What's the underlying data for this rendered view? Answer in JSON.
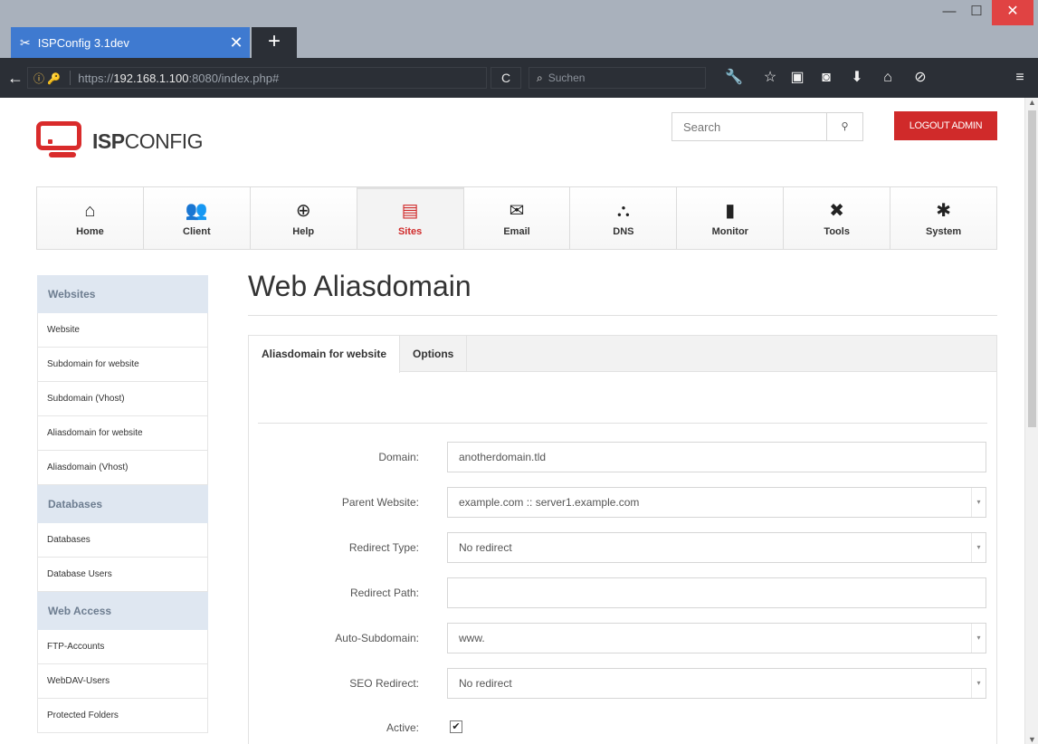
{
  "browser": {
    "tab_title": "ISPConfig 3.1dev",
    "tab_close": "✕",
    "new_tab": "+",
    "url_prefix": "https://",
    "url_host": "192.168.1.100",
    "url_rest": ":8080/index.php#",
    "search_placeholder": "Suchen",
    "window_min": "—",
    "window_max": "☐",
    "window_close": "✕"
  },
  "header": {
    "logo_bold": "ISP",
    "logo_rest": "CONFIG",
    "search_placeholder": "Search",
    "search_button": "🔍",
    "logout_label": "LOGOUT ADMIN"
  },
  "nav": {
    "tabs": [
      {
        "label": "Home",
        "icon": "home-icon",
        "glyph": "⌂"
      },
      {
        "label": "Client",
        "icon": "users-icon",
        "glyph": "👥"
      },
      {
        "label": "Help",
        "icon": "lifebuoy-icon",
        "glyph": "⊕"
      },
      {
        "label": "Sites",
        "icon": "sites-icon",
        "glyph": "▤"
      },
      {
        "label": "Email",
        "icon": "email-icon",
        "glyph": "✉"
      },
      {
        "label": "DNS",
        "icon": "dns-icon",
        "glyph": "⛬"
      },
      {
        "label": "Monitor",
        "icon": "monitor-icon",
        "glyph": "▮"
      },
      {
        "label": "Tools",
        "icon": "tools-icon",
        "glyph": "✖"
      },
      {
        "label": "System",
        "icon": "gear-icon",
        "glyph": "✱"
      }
    ],
    "active": "Sites"
  },
  "sidebar": {
    "websites_header": "Websites",
    "websites_items": [
      "Website",
      "Subdomain for website",
      "Subdomain (Vhost)",
      "Aliasdomain for website",
      "Aliasdomain (Vhost)"
    ],
    "databases_header": "Databases",
    "databases_items": [
      "Databases",
      "Database Users"
    ],
    "webaccess_header": "Web Access",
    "webaccess_items": [
      "FTP-Accounts",
      "WebDAV-Users",
      "Protected Folders"
    ]
  },
  "main": {
    "title": "Web Aliasdomain",
    "tabs": [
      "Aliasdomain for website",
      "Options"
    ],
    "form": {
      "domain_label": "Domain:",
      "domain_value": "anotherdomain.tld",
      "parent_label": "Parent Website:",
      "parent_value": "example.com :: server1.example.com",
      "redirect_type_label": "Redirect Type:",
      "redirect_type_value": "No redirect",
      "redirect_path_label": "Redirect Path:",
      "redirect_path_value": "",
      "auto_sub_label": "Auto-Subdomain:",
      "auto_sub_value": "www.",
      "seo_label": "SEO Redirect:",
      "seo_value": "No redirect",
      "active_label": "Active:",
      "active_checked": true,
      "active_mark": "✔"
    }
  },
  "colors": {
    "brand_red": "#d02a2a",
    "tab_blue": "#3f7ad0",
    "chrome_dark": "#2b2f36",
    "sidebar_header": "#dfe7f1"
  }
}
